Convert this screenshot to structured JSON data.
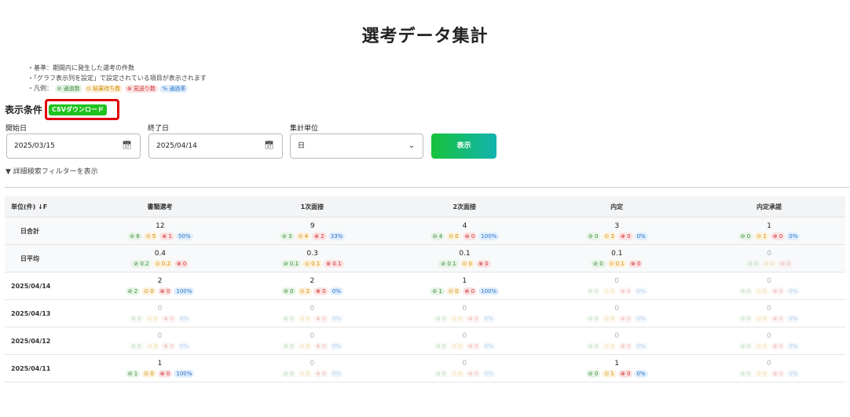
{
  "title": "選考データ集計",
  "notes": {
    "line1": "・基準：期間内に発生した選考の件数",
    "line2": "・「グラフ表示列を設定」で設定されている項目が表示されます",
    "line3_prefix": "・凡例：",
    "legend": {
      "pass": "⊘ 通過数",
      "wait": "⊙ 結果待ち数",
      "decline": "⊗ 見送り数",
      "rate": "% 通過率"
    }
  },
  "conditions": {
    "label": "表示条件",
    "csv_button": "CSVダウンロード",
    "start_label": "開始日",
    "start_value": "2025/03/15",
    "end_label": "終了日",
    "end_value": "2025/04/14",
    "unit_label": "集計単位",
    "unit_value": "日",
    "show_button": "表示",
    "filter_toggle": "▼ 詳細検索フィルターを表示"
  },
  "table": {
    "unit_header": "単位(件) ↓F",
    "categories": [
      "書類選考",
      "1次面接",
      "2次面接",
      "内定",
      "内定承諾"
    ],
    "rows": [
      {
        "label": "日合計",
        "cells": [
          {
            "total": "12",
            "p": "6",
            "w": "5",
            "d": "1",
            "r": "50%"
          },
          {
            "total": "9",
            "p": "3",
            "w": "4",
            "d": "2",
            "r": "33%"
          },
          {
            "total": "4",
            "p": "4",
            "w": "0",
            "d": "0",
            "r": "100%"
          },
          {
            "total": "3",
            "p": "0",
            "w": "3",
            "d": "0",
            "r": "0%"
          },
          {
            "total": "1",
            "p": "0",
            "w": "1",
            "d": "0",
            "r": "0%"
          }
        ]
      },
      {
        "label": "日平均",
        "cells": [
          {
            "total": "0.4",
            "p": "0.2",
            "w": "0.2",
            "d": "0"
          },
          {
            "total": "0.3",
            "p": "0.1",
            "w": "0.1",
            "d": "0.1"
          },
          {
            "total": "0.1",
            "p": "0.1",
            "w": "0",
            "d": "0"
          },
          {
            "total": "0.1",
            "p": "0",
            "w": "0.1",
            "d": "0"
          },
          {
            "total": "0",
            "p": "0",
            "w": "0",
            "d": "0"
          }
        ]
      },
      {
        "label": "2025/04/14",
        "cells": [
          {
            "total": "2",
            "p": "2",
            "w": "0",
            "d": "0",
            "r": "100%"
          },
          {
            "total": "2",
            "p": "0",
            "w": "2",
            "d": "0",
            "r": "0%"
          },
          {
            "total": "1",
            "p": "1",
            "w": "0",
            "d": "0",
            "r": "100%"
          },
          {
            "total": "0",
            "p": "0",
            "w": "0",
            "d": "0",
            "r": "0%"
          },
          {
            "total": "0",
            "p": "0",
            "w": "0",
            "d": "0",
            "r": "0%"
          }
        ]
      },
      {
        "label": "2025/04/13",
        "cells": [
          {
            "total": "0",
            "p": "0",
            "w": "0",
            "d": "0",
            "r": "0%"
          },
          {
            "total": "0",
            "p": "0",
            "w": "0",
            "d": "0",
            "r": "0%"
          },
          {
            "total": "0",
            "p": "0",
            "w": "0",
            "d": "0",
            "r": "0%"
          },
          {
            "total": "0",
            "p": "0",
            "w": "0",
            "d": "0",
            "r": "0%"
          },
          {
            "total": "0",
            "p": "0",
            "w": "0",
            "d": "0",
            "r": "0%"
          }
        ]
      },
      {
        "label": "2025/04/12",
        "cells": [
          {
            "total": "0",
            "p": "0",
            "w": "0",
            "d": "0",
            "r": "0%"
          },
          {
            "total": "0",
            "p": "0",
            "w": "0",
            "d": "0",
            "r": "0%"
          },
          {
            "total": "0",
            "p": "0",
            "w": "0",
            "d": "0",
            "r": "0%"
          },
          {
            "total": "0",
            "p": "0",
            "w": "0",
            "d": "0",
            "r": "0%"
          },
          {
            "total": "0",
            "p": "0",
            "w": "0",
            "d": "0",
            "r": "0%"
          }
        ]
      },
      {
        "label": "2025/04/11",
        "cells": [
          {
            "total": "1",
            "p": "1",
            "w": "0",
            "d": "0",
            "r": "100%"
          },
          {
            "total": "0",
            "p": "0",
            "w": "0",
            "d": "0",
            "r": "0%"
          },
          {
            "total": "0",
            "p": "0",
            "w": "0",
            "d": "0",
            "r": "0%"
          },
          {
            "total": "1",
            "p": "0",
            "w": "1",
            "d": "0",
            "r": "0%"
          },
          {
            "total": "0",
            "p": "0",
            "w": "0",
            "d": "0",
            "r": "0%"
          }
        ]
      }
    ]
  },
  "colors": {
    "pass": "#3a8a3a",
    "wait": "#d18a00",
    "decline": "#d03030",
    "rate": "#2a73c8",
    "csv_green": "#1ec21e",
    "highlight_red": "#e00000"
  }
}
